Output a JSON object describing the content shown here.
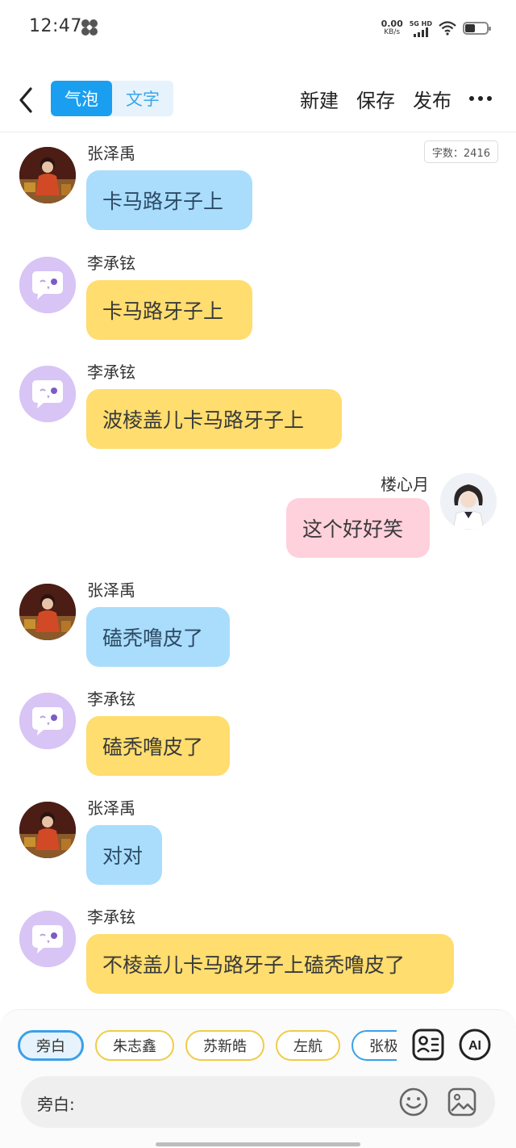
{
  "status_bar": {
    "time": "12:47",
    "net_speed_value": "0.00",
    "net_speed_unit": "KB/s",
    "signal_label": "5G HD"
  },
  "toolbar": {
    "tabs": [
      {
        "label": "气泡",
        "active": true
      },
      {
        "label": "文字",
        "active": false
      }
    ],
    "new_label": "新建",
    "save_label": "保存",
    "publish_label": "发布"
  },
  "word_count": "字数：2416",
  "messages": [
    {
      "name": "张泽禹",
      "text": "卡马路牙子上",
      "side": "left",
      "avatar": "photo-boy",
      "bubble_color": "#a9ddfb"
    },
    {
      "name": "李承铉",
      "text": "卡马路牙子上",
      "side": "left",
      "avatar": "bot",
      "bubble_color": "#ffdd6e"
    },
    {
      "name": "李承铉",
      "text": "波棱盖儿卡马路牙子上",
      "side": "left",
      "avatar": "bot",
      "bubble_color": "#ffdd6e"
    },
    {
      "name": "楼心月",
      "text": "这个好好笑",
      "side": "right",
      "avatar": "photo-girl",
      "bubble_color": "#ffd1dc"
    },
    {
      "name": "张泽禹",
      "text": "磕秃噜皮了",
      "side": "left",
      "avatar": "photo-boy",
      "bubble_color": "#a9ddfb"
    },
    {
      "name": "李承铉",
      "text": "磕秃噜皮了",
      "side": "left",
      "avatar": "bot",
      "bubble_color": "#ffdd6e"
    },
    {
      "name": "张泽禹",
      "text": "对对",
      "side": "left",
      "avatar": "photo-boy",
      "bubble_color": "#a9ddfb"
    },
    {
      "name": "李承铉",
      "text": "不棱盖儿卡马路牙子上磕秃噜皮了",
      "side": "left",
      "avatar": "bot",
      "bubble_color": "#ffdd6e"
    }
  ],
  "characters": [
    "旁白",
    "朱志鑫",
    "苏新皓",
    "左航",
    "张极"
  ],
  "selected_character": "旁白",
  "input": {
    "label": "旁白:",
    "value": "",
    "placeholder": ""
  },
  "icons": {
    "contact_card": "contact-card-icon",
    "ai": "AI",
    "emoji": "emoji-icon",
    "image": "image-icon"
  },
  "colors": {
    "accent": "#1a9ff0",
    "blue_bubble": "#a9ddfb",
    "yellow_bubble": "#ffdd6e",
    "pink_bubble": "#ffd1dc",
    "bot_avatar": "#d8c4f5"
  }
}
